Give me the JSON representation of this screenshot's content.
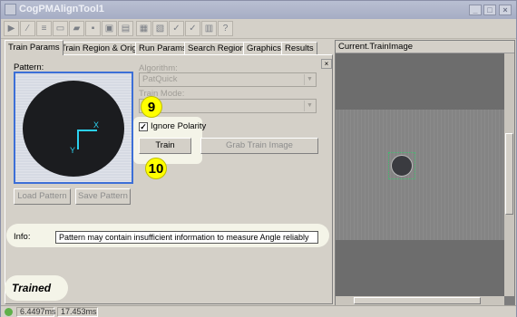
{
  "window": {
    "title": "CogPMAlignTool1"
  },
  "tabs": [
    {
      "label": "Train Params",
      "active": true
    },
    {
      "label": "Train Region & Origin"
    },
    {
      "label": "Run Params"
    },
    {
      "label": "Search Region"
    },
    {
      "label": "Graphics"
    },
    {
      "label": "Results"
    }
  ],
  "train_params": {
    "pattern_label": "Pattern:",
    "pattern_axes": {
      "x": "X",
      "y": "Y"
    },
    "algorithm_label": "Algorithm:",
    "algorithm_value": "PatQuick",
    "train_mode_label": "Train Mode:",
    "train_mode_value": "",
    "ignore_polarity_label": "Ignore Polarity",
    "ignore_polarity_checked": true,
    "train_button": "Train",
    "grab_train_image_button": "Grab Train Image",
    "load_pattern_button": "Load Pattern",
    "save_pattern_button": "Save Pattern",
    "info_label": "Info:",
    "info_value": "Pattern may contain insufficient information to measure Angle reliably",
    "close_glyph": "×"
  },
  "callouts": {
    "step_9": "9",
    "step_10": "10"
  },
  "status": {
    "trained_label": "Trained",
    "time_1": "6.4497ms",
    "time_2": "17.453ms"
  },
  "image_pane": {
    "title": "Current.TrainImage"
  },
  "colors": {
    "highlight": "#f4f4e8",
    "callout": "#ffff00",
    "pattern_axes": "#2bd1f0"
  }
}
